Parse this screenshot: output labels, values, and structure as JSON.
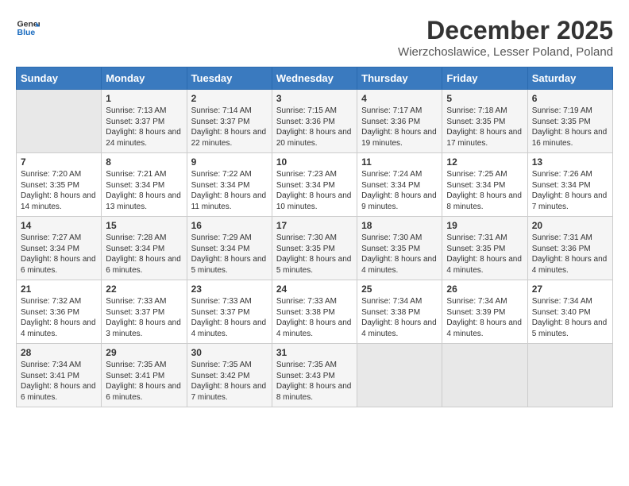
{
  "header": {
    "logo_line1": "General",
    "logo_line2": "Blue",
    "month": "December 2025",
    "location": "Wierzchoslawice, Lesser Poland, Poland"
  },
  "weekdays": [
    "Sunday",
    "Monday",
    "Tuesday",
    "Wednesday",
    "Thursday",
    "Friday",
    "Saturday"
  ],
  "weeks": [
    [
      {
        "day": "",
        "sunrise": "",
        "sunset": "",
        "daylight": ""
      },
      {
        "day": "1",
        "sunrise": "7:13 AM",
        "sunset": "3:37 PM",
        "daylight": "8 hours and 24 minutes."
      },
      {
        "day": "2",
        "sunrise": "7:14 AM",
        "sunset": "3:37 PM",
        "daylight": "8 hours and 22 minutes."
      },
      {
        "day": "3",
        "sunrise": "7:15 AM",
        "sunset": "3:36 PM",
        "daylight": "8 hours and 20 minutes."
      },
      {
        "day": "4",
        "sunrise": "7:17 AM",
        "sunset": "3:36 PM",
        "daylight": "8 hours and 19 minutes."
      },
      {
        "day": "5",
        "sunrise": "7:18 AM",
        "sunset": "3:35 PM",
        "daylight": "8 hours and 17 minutes."
      },
      {
        "day": "6",
        "sunrise": "7:19 AM",
        "sunset": "3:35 PM",
        "daylight": "8 hours and 16 minutes."
      }
    ],
    [
      {
        "day": "7",
        "sunrise": "7:20 AM",
        "sunset": "3:35 PM",
        "daylight": "8 hours and 14 minutes."
      },
      {
        "day": "8",
        "sunrise": "7:21 AM",
        "sunset": "3:34 PM",
        "daylight": "8 hours and 13 minutes."
      },
      {
        "day": "9",
        "sunrise": "7:22 AM",
        "sunset": "3:34 PM",
        "daylight": "8 hours and 11 minutes."
      },
      {
        "day": "10",
        "sunrise": "7:23 AM",
        "sunset": "3:34 PM",
        "daylight": "8 hours and 10 minutes."
      },
      {
        "day": "11",
        "sunrise": "7:24 AM",
        "sunset": "3:34 PM",
        "daylight": "8 hours and 9 minutes."
      },
      {
        "day": "12",
        "sunrise": "7:25 AM",
        "sunset": "3:34 PM",
        "daylight": "8 hours and 8 minutes."
      },
      {
        "day": "13",
        "sunrise": "7:26 AM",
        "sunset": "3:34 PM",
        "daylight": "8 hours and 7 minutes."
      }
    ],
    [
      {
        "day": "14",
        "sunrise": "7:27 AM",
        "sunset": "3:34 PM",
        "daylight": "8 hours and 6 minutes."
      },
      {
        "day": "15",
        "sunrise": "7:28 AM",
        "sunset": "3:34 PM",
        "daylight": "8 hours and 6 minutes."
      },
      {
        "day": "16",
        "sunrise": "7:29 AM",
        "sunset": "3:34 PM",
        "daylight": "8 hours and 5 minutes."
      },
      {
        "day": "17",
        "sunrise": "7:30 AM",
        "sunset": "3:35 PM",
        "daylight": "8 hours and 5 minutes."
      },
      {
        "day": "18",
        "sunrise": "7:30 AM",
        "sunset": "3:35 PM",
        "daylight": "8 hours and 4 minutes."
      },
      {
        "day": "19",
        "sunrise": "7:31 AM",
        "sunset": "3:35 PM",
        "daylight": "8 hours and 4 minutes."
      },
      {
        "day": "20",
        "sunrise": "7:31 AM",
        "sunset": "3:36 PM",
        "daylight": "8 hours and 4 minutes."
      }
    ],
    [
      {
        "day": "21",
        "sunrise": "7:32 AM",
        "sunset": "3:36 PM",
        "daylight": "8 hours and 4 minutes."
      },
      {
        "day": "22",
        "sunrise": "7:33 AM",
        "sunset": "3:37 PM",
        "daylight": "8 hours and 3 minutes."
      },
      {
        "day": "23",
        "sunrise": "7:33 AM",
        "sunset": "3:37 PM",
        "daylight": "8 hours and 4 minutes."
      },
      {
        "day": "24",
        "sunrise": "7:33 AM",
        "sunset": "3:38 PM",
        "daylight": "8 hours and 4 minutes."
      },
      {
        "day": "25",
        "sunrise": "7:34 AM",
        "sunset": "3:38 PM",
        "daylight": "8 hours and 4 minutes."
      },
      {
        "day": "26",
        "sunrise": "7:34 AM",
        "sunset": "3:39 PM",
        "daylight": "8 hours and 4 minutes."
      },
      {
        "day": "27",
        "sunrise": "7:34 AM",
        "sunset": "3:40 PM",
        "daylight": "8 hours and 5 minutes."
      }
    ],
    [
      {
        "day": "28",
        "sunrise": "7:34 AM",
        "sunset": "3:41 PM",
        "daylight": "8 hours and 6 minutes."
      },
      {
        "day": "29",
        "sunrise": "7:35 AM",
        "sunset": "3:41 PM",
        "daylight": "8 hours and 6 minutes."
      },
      {
        "day": "30",
        "sunrise": "7:35 AM",
        "sunset": "3:42 PM",
        "daylight": "8 hours and 7 minutes."
      },
      {
        "day": "31",
        "sunrise": "7:35 AM",
        "sunset": "3:43 PM",
        "daylight": "8 hours and 8 minutes."
      },
      {
        "day": "",
        "sunrise": "",
        "sunset": "",
        "daylight": ""
      },
      {
        "day": "",
        "sunrise": "",
        "sunset": "",
        "daylight": ""
      },
      {
        "day": "",
        "sunrise": "",
        "sunset": "",
        "daylight": ""
      }
    ]
  ]
}
